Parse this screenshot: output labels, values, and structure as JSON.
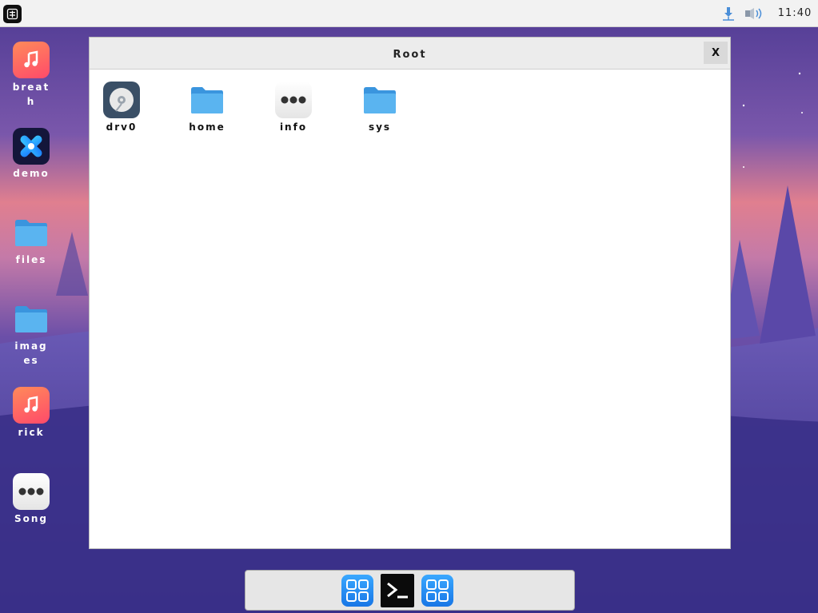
{
  "topbar": {
    "start_icon": "launcher-icon",
    "tray_icons": [
      "network-icon",
      "volume-icon"
    ],
    "clock": "11:40"
  },
  "desktop_icons": [
    {
      "label": "breath",
      "icon": "music-app-icon"
    },
    {
      "label": "demo",
      "icon": "demo-app-icon"
    },
    {
      "label": "files",
      "icon": "folder-icon"
    },
    {
      "label": "images",
      "icon": "folder-icon"
    },
    {
      "label": "rick",
      "icon": "music-app-icon"
    },
    {
      "label": "Song",
      "icon": "more-dots-icon"
    }
  ],
  "window": {
    "title": "Root",
    "close_label": "X",
    "items": [
      {
        "label": "drv0",
        "icon": "drive-icon"
      },
      {
        "label": "home",
        "icon": "folder-icon"
      },
      {
        "label": "info",
        "icon": "more-dots-icon"
      },
      {
        "label": "sys",
        "icon": "folder-icon"
      }
    ]
  },
  "dock": {
    "items": [
      "app-grid-icon",
      "terminal-icon",
      "app-grid-icon"
    ]
  },
  "colors": {
    "folder": "#4aa8e8",
    "window_bg": "#ffffff",
    "titlebar": "#ececec"
  }
}
